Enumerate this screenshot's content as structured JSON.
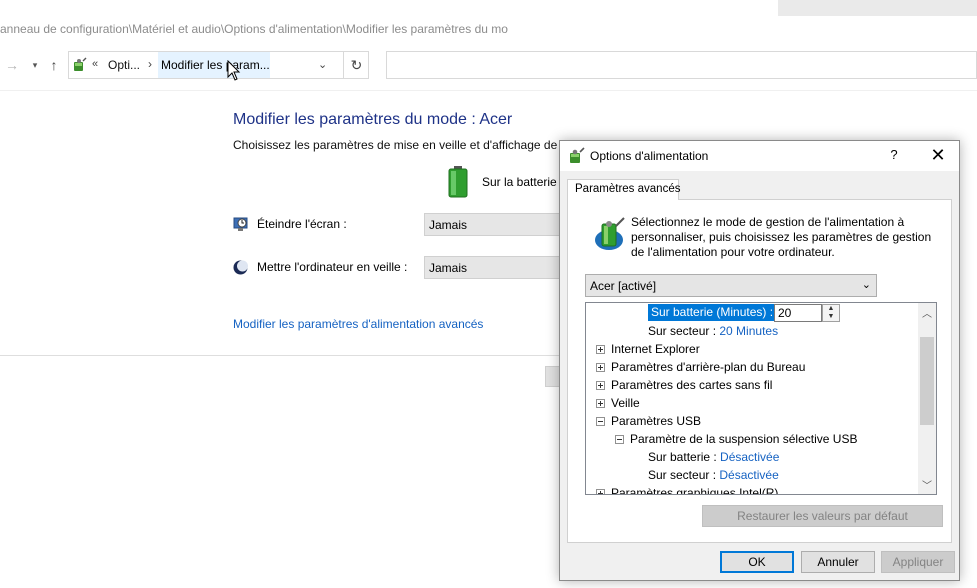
{
  "window": {
    "title": "anneau de configuration\\Matériel et audio\\Options d'alimentation\\Modifier les paramètres du mo"
  },
  "nav": {
    "breadcrumb_overflow": "«",
    "crumb1": "Opti...",
    "crumb_sep": "›",
    "crumb2": "Modifier les param..."
  },
  "page": {
    "title": "Modifier les paramètres du mode : Acer",
    "description": "Choisissez les paramètres de mise en veille et d'affichage de vo",
    "on_battery_column": "Sur la batterie",
    "screen_off_label": "Éteindre l'écran :",
    "screen_off_value": "Jamais",
    "sleep_label": "Mettre l'ordinateur en veille :",
    "sleep_value": "Jamais",
    "advanced_link": "Modifier les paramètres d'alimentation avancés"
  },
  "dialog": {
    "title": "Options d'alimentation",
    "help": "?",
    "close": "✕",
    "tab": "Paramètres avancés",
    "intro": "Sélectionnez le mode de gestion de l'alimentation à personnaliser, puis choisissez les paramètres de gestion de l'alimentation pour votre ordinateur.",
    "plan_selected": "Acer [activé]",
    "tree": {
      "battery_label": "Sur batterie (Minutes) :",
      "battery_value": "20",
      "ac_label": "Sur secteur :",
      "ac_value": "20 Minutes",
      "items": [
        "Internet Explorer",
        "Paramètres d'arrière-plan du Bureau",
        "Paramètres des cartes sans fil",
        "Veille",
        "Paramètres USB"
      ],
      "usb_child": "Paramètre de la suspension sélective USB",
      "usb_battery_label": "Sur batterie :",
      "usb_battery_value": "Désactivée",
      "usb_ac_label": "Sur secteur :",
      "usb_ac_value": "Désactivée",
      "cut_item": "Paramètres graphiques Intel(R)"
    },
    "restore_button": "Restaurer les valeurs par défaut",
    "ok": "OK",
    "cancel": "Annuler",
    "apply": "Appliquer"
  },
  "colors": {
    "link": "#1562c2",
    "title": "#1e3287",
    "selection": "#0078d7"
  }
}
